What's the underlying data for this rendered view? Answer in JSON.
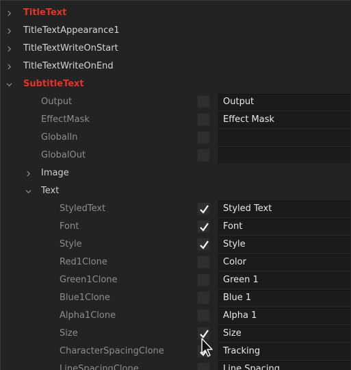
{
  "groups": {
    "title_text": "TitleText",
    "title_text_appearance": "TitleTextAppearance1",
    "title_text_write_on_start": "TitleTextWriteOnStart",
    "title_text_write_on_end": "TitleTextWriteOnEnd",
    "subtitle_text": "SubtitleText"
  },
  "subtitle": {
    "props": [
      {
        "label": "Output",
        "checked": false,
        "value": "Output"
      },
      {
        "label": "EffectMask",
        "checked": false,
        "value": "Effect Mask"
      },
      {
        "label": "GlobalIn",
        "checked": false,
        "value": ""
      },
      {
        "label": "GlobalOut",
        "checked": false,
        "value": ""
      }
    ],
    "image_group": "Image",
    "text_group": "Text",
    "text_props": [
      {
        "label": "StyledText",
        "checked": true,
        "value": "Styled Text"
      },
      {
        "label": "Font",
        "checked": true,
        "value": "Font"
      },
      {
        "label": "Style",
        "checked": true,
        "value": "Style"
      },
      {
        "label": "Red1Clone",
        "checked": false,
        "value": "Color"
      },
      {
        "label": "Green1Clone",
        "checked": false,
        "value": "Green 1"
      },
      {
        "label": "Blue1Clone",
        "checked": false,
        "value": "Blue 1"
      },
      {
        "label": "Alpha1Clone",
        "checked": false,
        "value": "Alpha 1"
      },
      {
        "label": "Size",
        "checked": true,
        "value": "Size"
      },
      {
        "label": "CharacterSpacingClone",
        "checked": true,
        "value": "Tracking"
      },
      {
        "label": "LineSpacingClone",
        "checked": false,
        "value": "Line Spacing"
      }
    ]
  },
  "colors": {
    "accent_red": "#e5332a",
    "background": "#232323",
    "field_bg": "#1b1b1b",
    "checkbox_bg": "#2f2f2f"
  },
  "icons": {
    "collapsed": "chevron-right-icon",
    "expanded": "chevron-down-icon",
    "check": "checkmark-icon",
    "cursor": "mouse-pointer-icon"
  }
}
